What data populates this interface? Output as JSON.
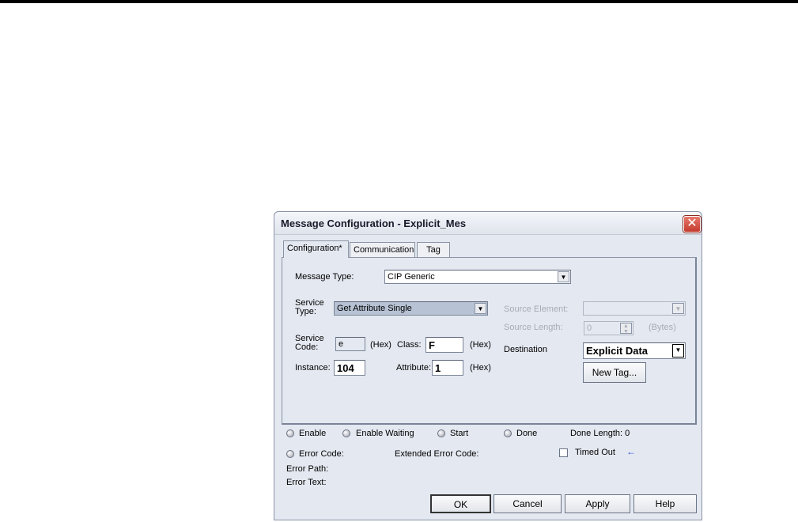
{
  "dialog": {
    "title": "Message Configuration - Explicit_Mes",
    "close": "✕"
  },
  "tabs": [
    {
      "label": "Configuration*"
    },
    {
      "label": "Communication"
    },
    {
      "label": "Tag"
    }
  ],
  "config": {
    "message_type_label": "Message Type:",
    "message_type": "CIP Generic",
    "service_type_label": "Service\nType:",
    "service_type": "Get Attribute Single",
    "source_element_label": "Source Element:",
    "source_element": "",
    "source_length_label": "Source Length:",
    "source_length": "0",
    "bytes": "(Bytes)",
    "service_code_label": "Service\nCode:",
    "service_code": "e",
    "hex": "(Hex)",
    "class_label": "Class:",
    "class": "F",
    "destination_label": "Destination",
    "destination": "Explicit Data",
    "instance_label": "Instance:",
    "instance": "104",
    "attribute_label": "Attribute:",
    "attribute": "1",
    "new_tag": "New Tag..."
  },
  "status": {
    "enable": "Enable",
    "enable_waiting": "Enable Waiting",
    "start": "Start",
    "done": "Done",
    "done_length": "Done Length: 0",
    "error_code": "Error Code:",
    "extended_error_code": "Extended Error Code:",
    "timed_out": "Timed Out",
    "timed_out_checked": false,
    "error_path": "Error Path:",
    "error_text": "Error Text:"
  },
  "buttons": {
    "ok": "OK",
    "cancel": "Cancel",
    "apply": "Apply",
    "help": "Help"
  },
  "colors": {
    "accent_arrow": "#2a4fd0"
  }
}
